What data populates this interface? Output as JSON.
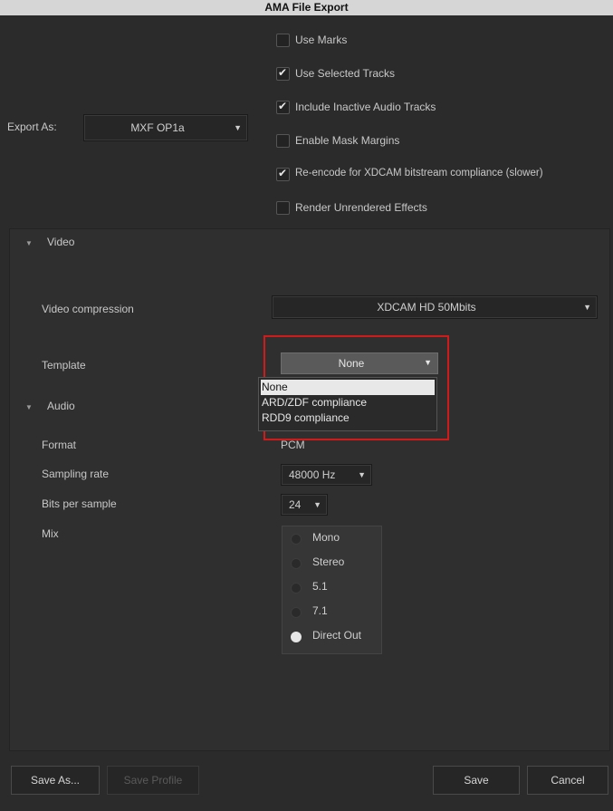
{
  "window": {
    "title": "AMA File Export"
  },
  "export": {
    "label": "Export As:",
    "format_value": "MXF OP1a"
  },
  "options": [
    {
      "label": "Use Marks",
      "checked": false
    },
    {
      "label": "Use Selected Tracks",
      "checked": true
    },
    {
      "label": "Include Inactive Audio Tracks",
      "checked": true
    },
    {
      "label": "Enable Mask Margins",
      "checked": false
    },
    {
      "label": "Re-encode for XDCAM bitstream compliance (slower)",
      "checked": true
    },
    {
      "label": "Render Unrendered Effects",
      "checked": false
    }
  ],
  "video": {
    "section": "Video",
    "compression_label": "Video compression",
    "compression_value": "XDCAM HD 50Mbits",
    "template_label": "Template",
    "template_value": "None",
    "template_options": [
      "None",
      "ARD/ZDF compliance",
      "RDD9 compliance"
    ],
    "template_selected_index": 0
  },
  "audio": {
    "section": "Audio",
    "format_label": "Format",
    "format_value": "PCM",
    "sampling_label": "Sampling rate",
    "sampling_value": "48000 Hz",
    "bits_label": "Bits per sample",
    "bits_value": "24",
    "mix_label": "Mix",
    "mix_options": [
      "Mono",
      "Stereo",
      "5.1",
      "7.1",
      "Direct Out"
    ],
    "mix_selected": "Direct Out"
  },
  "buttons": {
    "save_as": "Save As...",
    "save_profile": "Save Profile",
    "save": "Save",
    "cancel": "Cancel"
  },
  "colors": {
    "highlight": "#d11a1a",
    "background": "#2b2b2b"
  }
}
